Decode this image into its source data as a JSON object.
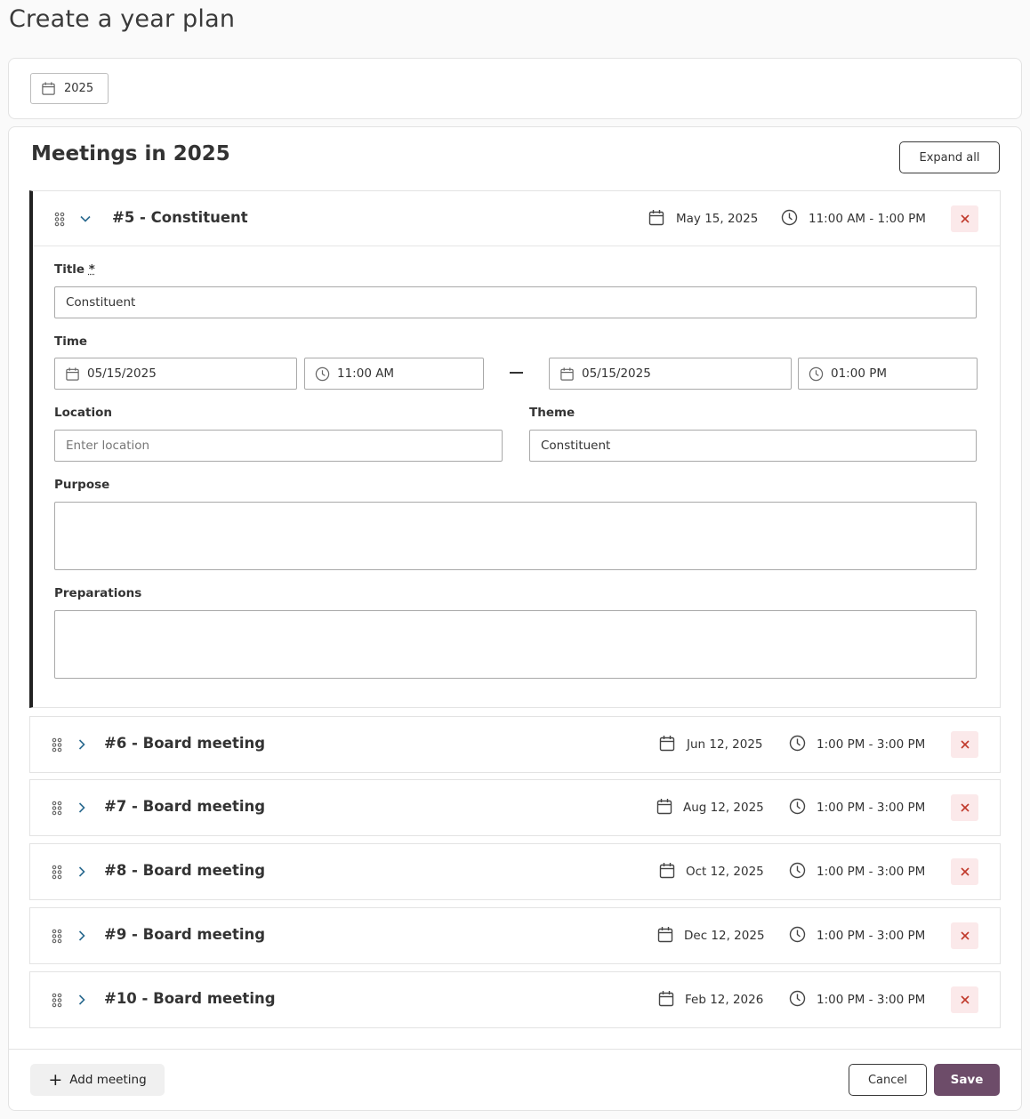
{
  "page": {
    "title": "Create a year plan"
  },
  "year_picker": {
    "value": "2025"
  },
  "section": {
    "title": "Meetings in 2025",
    "expand_all": "Expand all"
  },
  "expanded_meeting": {
    "title": "#5 - Constituent",
    "date": "May 15, 2025",
    "time": "11:00 AM - 1:00 PM",
    "form": {
      "title_label": "Title",
      "required_mark": "*",
      "title_value": "Constituent",
      "time_label": "Time",
      "start_date": "05/15/2025",
      "start_time": "11:00 AM",
      "end_date": "05/15/2025",
      "end_time": "01:00 PM",
      "location_label": "Location",
      "location_placeholder": "Enter location",
      "theme_label": "Theme",
      "theme_value": "Constituent",
      "purpose_label": "Purpose",
      "preparations_label": "Preparations"
    }
  },
  "meetings": [
    {
      "title": "#6 - Board meeting",
      "date": "Jun 12, 2025",
      "time": "1:00 PM - 3:00 PM"
    },
    {
      "title": "#7 - Board meeting",
      "date": "Aug 12, 2025",
      "time": "1:00 PM - 3:00 PM"
    },
    {
      "title": "#8 - Board meeting",
      "date": "Oct 12, 2025",
      "time": "1:00 PM - 3:00 PM"
    },
    {
      "title": "#9 - Board meeting",
      "date": "Dec 12, 2025",
      "time": "1:00 PM - 3:00 PM"
    },
    {
      "title": "#10 - Board meeting",
      "date": "Feb 12, 2026",
      "time": "1:00 PM - 3:00 PM"
    }
  ],
  "footer": {
    "add_meeting": "Add meeting",
    "cancel": "Cancel",
    "save": "Save"
  },
  "icons": {
    "calendar": "calendar-icon",
    "clock": "clock-icon",
    "drag": "drag-handle-icon",
    "chevron_down": "chevron-down-icon",
    "chevron_right": "chevron-right-icon",
    "close": "close-icon",
    "plus": "plus-icon"
  },
  "colors": {
    "primary": "#6d4c69",
    "delete_bg": "#fbe9ea",
    "delete_x": "#c0392b",
    "chevron": "#2b6a8f"
  }
}
